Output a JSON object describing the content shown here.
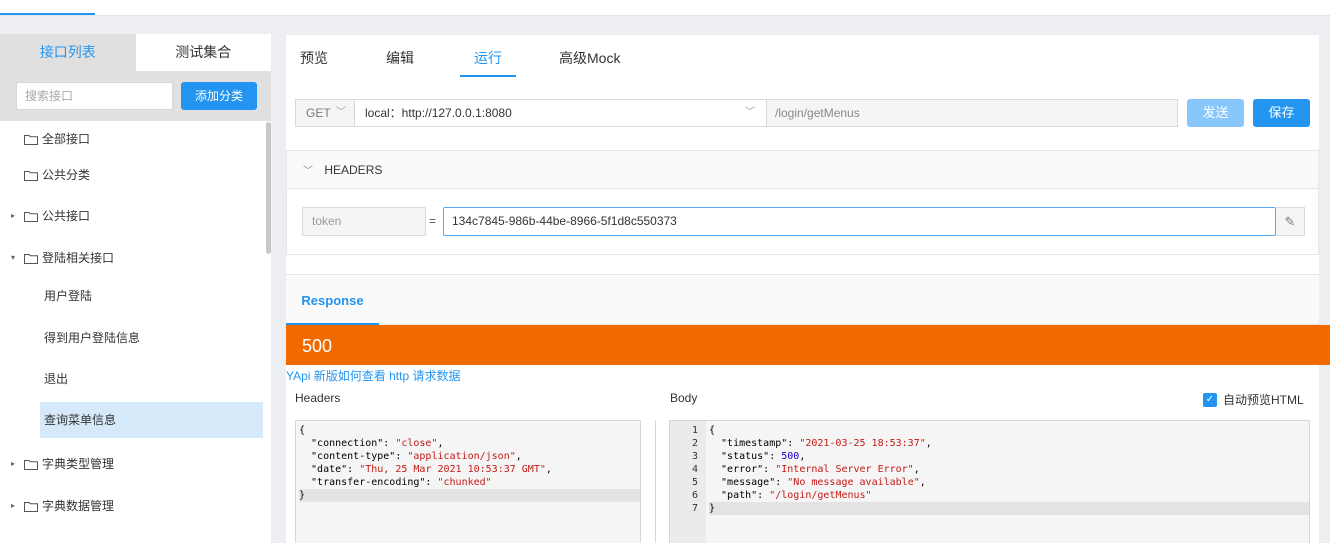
{
  "sidebar": {
    "tabs": [
      "接口列表",
      "测试集合"
    ],
    "search_placeholder": "搜索接口",
    "add_button": "添加分类",
    "tree": [
      {
        "label": "全部接口",
        "has_caret": false
      },
      {
        "label": "公共分类",
        "has_caret": false
      },
      {
        "label": "公共接口",
        "has_caret": true,
        "expanded": false
      },
      {
        "label": "登陆相关接口",
        "has_caret": true,
        "expanded": true
      },
      {
        "label": "字典类型管理",
        "has_caret": true,
        "expanded": false
      },
      {
        "label": "字典数据管理",
        "has_caret": true,
        "expanded": false
      }
    ],
    "sub_items": [
      "用户登陆",
      "得到用户登陆信息",
      "退出",
      "查询菜单信息"
    ],
    "selected_sub_item": "查询菜单信息"
  },
  "main": {
    "tabs": [
      "预览",
      "编辑",
      "运行",
      "高级Mock"
    ],
    "active_tab": "运行",
    "request": {
      "method": "GET",
      "env": "local：http://127.0.0.1:8080",
      "path": "/login/getMenus",
      "send_label": "发送",
      "save_label": "保存"
    },
    "headers_section": {
      "title": "HEADERS",
      "key": "token",
      "eq": "=",
      "value": "134c7845-986b-44be-8966-5f1d8c550373"
    },
    "response": {
      "tab_label": "Response",
      "status": "500",
      "help_link": "YApi 新版如何查看 http 请求数据",
      "headers_title": "Headers",
      "body_title": "Body",
      "preview_html_label": "自动预览HTML",
      "preview_html_checked": true,
      "headers_code": [
        {
          "parts": [
            {
              "t": "{",
              "c": "key"
            }
          ]
        },
        {
          "parts": [
            {
              "t": "  \"connection\": ",
              "c": "key"
            },
            {
              "t": "\"close\"",
              "c": "str"
            },
            {
              "t": ",",
              "c": "key"
            }
          ]
        },
        {
          "parts": [
            {
              "t": "  \"content-type\": ",
              "c": "key"
            },
            {
              "t": "\"application/json\"",
              "c": "str"
            },
            {
              "t": ",",
              "c": "key"
            }
          ]
        },
        {
          "parts": [
            {
              "t": "  \"date\": ",
              "c": "key"
            },
            {
              "t": "\"Thu, 25 Mar 2021 10:53:37 GMT\"",
              "c": "str"
            },
            {
              "t": ",",
              "c": "key"
            }
          ]
        },
        {
          "parts": [
            {
              "t": "  \"transfer-encoding\": ",
              "c": "key"
            },
            {
              "t": "\"chunked\"",
              "c": "str"
            }
          ]
        },
        {
          "parts": [
            {
              "t": "}",
              "c": "key"
            }
          ],
          "hl": true
        }
      ],
      "body_line_numbers": [
        "1",
        "2",
        "3",
        "4",
        "5",
        "6",
        "7"
      ],
      "body_code": [
        {
          "parts": [
            {
              "t": "{",
              "c": "key"
            }
          ]
        },
        {
          "parts": [
            {
              "t": "  \"timestamp\": ",
              "c": "key"
            },
            {
              "t": "\"2021-03-25 18:53:37\"",
              "c": "str"
            },
            {
              "t": ",",
              "c": "key"
            }
          ]
        },
        {
          "parts": [
            {
              "t": "  \"status\": ",
              "c": "key"
            },
            {
              "t": "500",
              "c": "num"
            },
            {
              "t": ",",
              "c": "key"
            }
          ]
        },
        {
          "parts": [
            {
              "t": "  \"error\": ",
              "c": "key"
            },
            {
              "t": "\"Internal Server Error\"",
              "c": "str"
            },
            {
              "t": ",",
              "c": "key"
            }
          ]
        },
        {
          "parts": [
            {
              "t": "  \"message\": ",
              "c": "key"
            },
            {
              "t": "\"No message available\"",
              "c": "str"
            },
            {
              "t": ",",
              "c": "key"
            }
          ]
        },
        {
          "parts": [
            {
              "t": "  \"path\": ",
              "c": "key"
            },
            {
              "t": "\"/login/getMenus\"",
              "c": "str"
            }
          ]
        },
        {
          "parts": [
            {
              "t": "}",
              "c": "key"
            }
          ],
          "hl": true
        }
      ]
    }
  },
  "colors": {
    "accent": "#2395f1",
    "status_error": "#f06a00",
    "string": "#c41a16",
    "number": "#1c00cf"
  }
}
